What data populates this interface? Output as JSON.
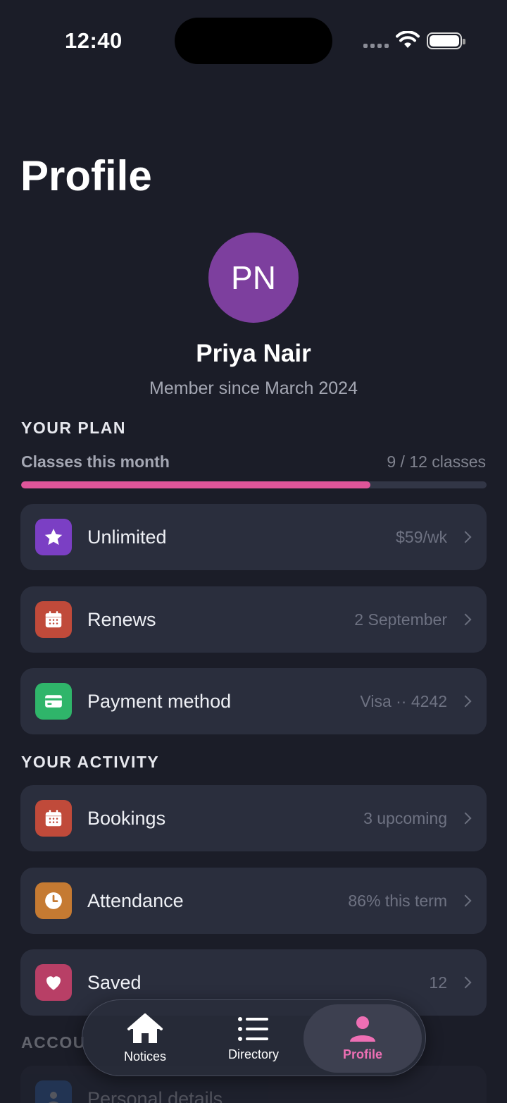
{
  "status_bar": {
    "time": "12:40"
  },
  "header": {
    "title": "Profile"
  },
  "profile": {
    "initials": "PN",
    "name": "Priya Nair",
    "member_since": "Member since March 2024"
  },
  "plan": {
    "section_title": "YOUR PLAN",
    "usage_label": "Classes this month",
    "usage_value": "9 / 12 classes",
    "usage_fraction": 0.75,
    "accent_color": "#e0559a",
    "rows": [
      {
        "icon": "star-icon",
        "label": "Unlimited",
        "value": "$59/wk",
        "color": "#7b3fc4"
      },
      {
        "icon": "calendar-icon",
        "label": "Renews",
        "value": "2 September",
        "color": "#c04a3a"
      },
      {
        "icon": "card-icon",
        "label": "Payment method",
        "value": "Visa ·· 4242",
        "color": "#2fb56a"
      }
    ]
  },
  "activity": {
    "section_title": "YOUR ACTIVITY",
    "rows": [
      {
        "icon": "calendar-icon",
        "label": "Bookings",
        "value": "3 upcoming",
        "color": "#c04a3a"
      },
      {
        "icon": "clock-icon",
        "label": "Attendance",
        "value": "86% this term",
        "color": "#c57a32"
      },
      {
        "icon": "heart-icon",
        "label": "Saved",
        "value": "12",
        "color": "#b83f66"
      }
    ]
  },
  "account": {
    "section_title": "ACCOU",
    "rows": [
      {
        "icon": "person-icon",
        "label": "Personal details",
        "color": "#3a7bd5"
      }
    ]
  },
  "tab_bar": {
    "tabs": [
      {
        "label": "Notices",
        "icon": "house-icon"
      },
      {
        "label": "Directory",
        "icon": "list-icon"
      },
      {
        "label": "Profile",
        "icon": "person-icon",
        "active": true
      }
    ]
  }
}
